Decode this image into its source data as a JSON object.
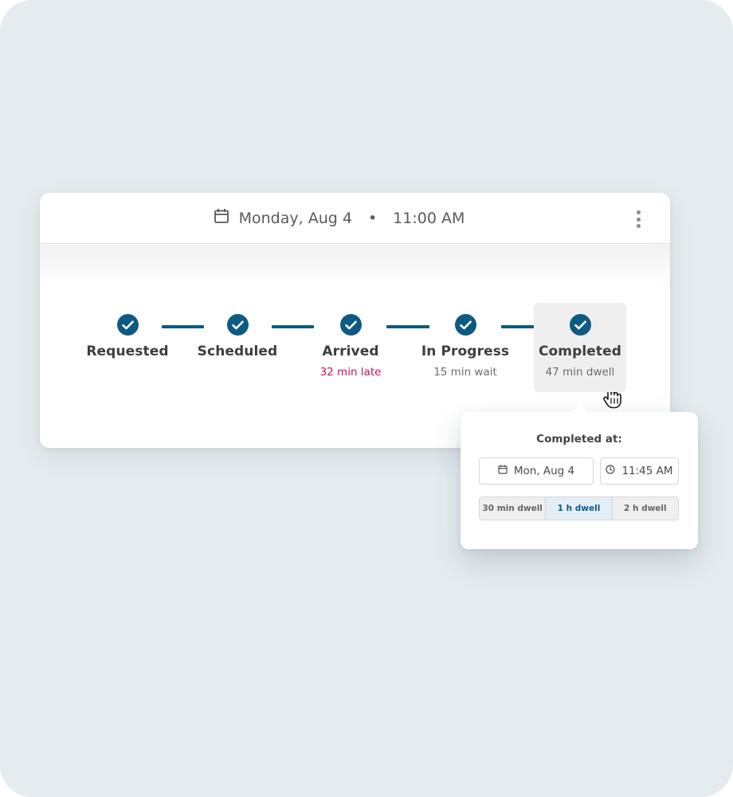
{
  "header": {
    "date": "Monday, Aug 4",
    "separator": "•",
    "time": "11:00 AM"
  },
  "steps": [
    {
      "label": "Requested",
      "sub": ""
    },
    {
      "label": "Scheduled",
      "sub": ""
    },
    {
      "label": "Arrived",
      "sub": "32 min late"
    },
    {
      "label": "In Progress",
      "sub": "15 min wait"
    },
    {
      "label": "Completed",
      "sub": "47 min dwell"
    }
  ],
  "popover": {
    "title": "Completed at:",
    "date_value": "Mon, Aug 4",
    "time_value": "11:45 AM",
    "dwell_options": [
      "30 min dwell",
      "1 h dwell",
      "2 h dwell"
    ],
    "selected_option": "1 h dwell"
  },
  "colors": {
    "accent": "#0d5a84",
    "late": "#c4145b",
    "backdrop": "#e5ecef"
  }
}
